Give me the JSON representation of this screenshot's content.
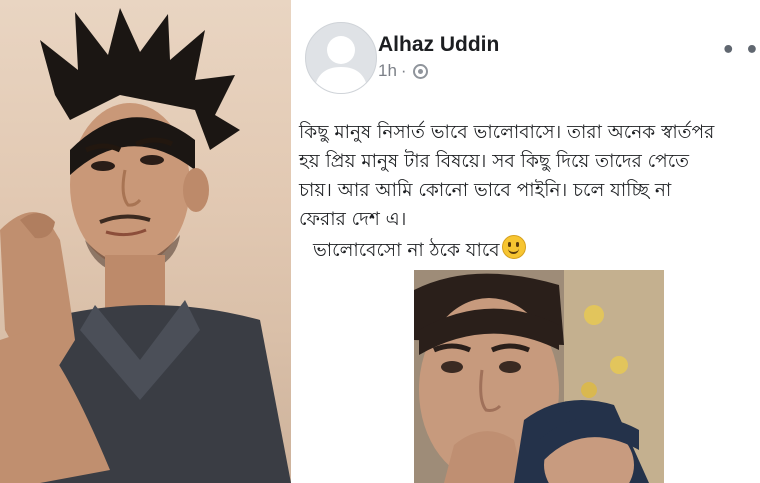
{
  "post": {
    "author_name": "Alhaz Uddin",
    "timestamp": "1h",
    "separator": "·",
    "privacy_icon": "globe-icon",
    "more_label": "• •",
    "text_lines": [
      "কিছু মানুষ নিসার্ত ভাবে ভালোবাসে। তারা অনেক স্বার্তপর",
      "হয় প্রিয় মানুষ টার বিষয়ে। সব কিছু দিয়ে তাদের পেতে",
      "চায়। আর আমি কোনো ভাবে পাইনি। চলে যাচ্ছি না",
      "ফেরার দেশ এ।",
      "ভালোবেসো না ঠকে যাবে"
    ],
    "emoji_icon": "smiley-emoji-icon"
  },
  "colors": {
    "author_text": "#1c1e21",
    "meta_text": "#7c8088",
    "avatar_bg": "#dfe2e6"
  }
}
